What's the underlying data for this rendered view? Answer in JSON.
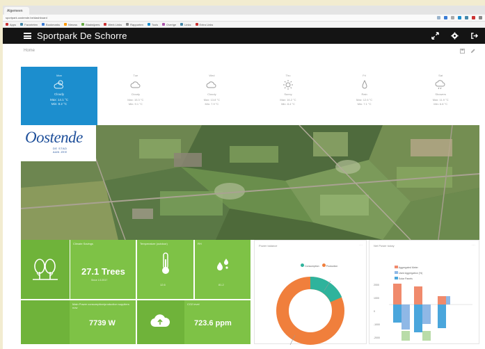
{
  "browser": {
    "tab_title": "Algemeen",
    "url": "sportpark.oostende.be/dashboard",
    "bookmarks": [
      "Apps",
      "Favorieten",
      "Bookmarks",
      "Nieuws",
      "Bladwijzers",
      "Werk Links",
      "Rapporten",
      "Tools",
      "Overige",
      "Links",
      "Extra Links"
    ]
  },
  "app": {
    "title": "Sportpark De Schorre",
    "breadcrumb": "Home"
  },
  "weather": [
    {
      "label": "Mon",
      "condition": "Cloudy",
      "line1": "Max: 14.1 °C",
      "line2": "Min: 8.2 °C",
      "icon": "cloud-sun-icon"
    },
    {
      "label": "Tue",
      "condition": "Cloudy",
      "line1": "Max: 15.3 °C",
      "line2": "Min: 9.1 °C",
      "icon": "cloud-icon"
    },
    {
      "label": "Wed",
      "condition": "Cloudy",
      "line1": "Max: 13.8 °C",
      "line2": "Min: 7.9 °C",
      "icon": "cloud-icon"
    },
    {
      "label": "Thu",
      "condition": "Sunny",
      "line1": "Max: 16.2 °C",
      "line2": "Min: 8.4 °C",
      "icon": "sun-icon"
    },
    {
      "label": "Fri",
      "condition": "Rain",
      "line1": "Max: 12.6 °C",
      "line2": "Min: 7.1 °C",
      "icon": "rain-icon"
    },
    {
      "label": "Sat",
      "condition": "Showers",
      "line1": "Max: 11.9 °C",
      "line2": "Min: 6.8 °C",
      "icon": "cloud-rain-icon"
    }
  ],
  "logo": {
    "name": "Oostende",
    "tag1": "DE STAD",
    "tag2": "AAN ZEE"
  },
  "tiles": {
    "trees": {
      "label": "Climate Savings",
      "value": "27.1 Trees",
      "sub": "Since 1/1/2017"
    },
    "temperature": {
      "label": "Temperature (outdoor)",
      "value": "12.6"
    },
    "rh": {
      "label": "RH",
      "value": "81.2"
    },
    "power": {
      "label": "Main Power consumption/production suppliers now",
      "value": "7739 W"
    },
    "co2": {
      "label": "CO2 level",
      "value": "723.6 ppm"
    }
  },
  "donut": {
    "title": "Power balance",
    "legend": [
      "Consumption",
      "Production"
    ],
    "colors": {
      "consumption": "#2fb39c",
      "production": "#f07f3c"
    }
  },
  "bars": {
    "title": "Net Power today",
    "legend": [
      "Aggregated Meter",
      "Used Aggregation (%)",
      "Solar Panels"
    ],
    "axis": [
      "2000",
      "1000",
      "0",
      "-1000",
      "-2000"
    ],
    "colors": {
      "meter": "#f08a6c",
      "solar": "#4aa6dc",
      "agg": "#8fb8e6"
    }
  },
  "colors": {
    "accent": "#1c8ece",
    "green": "#7ec246",
    "green_dark": "#6fb33a",
    "header": "#141414"
  }
}
